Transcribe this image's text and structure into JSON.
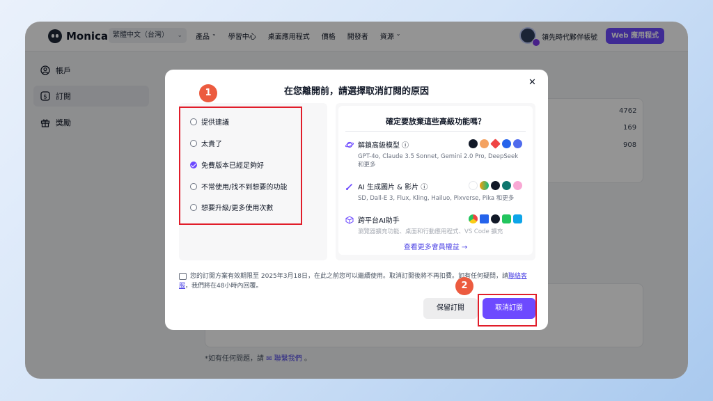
{
  "nav": {
    "brand": "Monica",
    "language": "繁體中文（台灣）",
    "links": [
      "產品",
      "學習中心",
      "桌面應用程式",
      "價格",
      "開發者",
      "資源"
    ],
    "account_label": "領先時代夥伴帳號",
    "web_app_button": "Web 應用程式"
  },
  "sidebar": {
    "items": [
      {
        "label": "帳戶",
        "icon": "user-circle-icon"
      },
      {
        "label": "訂閱",
        "icon": "dollar-icon"
      },
      {
        "label": "獎勵",
        "icon": "gift-icon"
      }
    ]
  },
  "background": {
    "numbers": [
      "4762",
      "169",
      "908"
    ],
    "footer_prefix": "*如有任何問題，請",
    "footer_link": "聯繫我們",
    "footer_suffix": "。"
  },
  "modal": {
    "title": "在您離開前，請選擇取消訂閱的原因",
    "reasons": [
      {
        "label": "提供建議",
        "checked": false
      },
      {
        "label": "太貴了",
        "checked": false
      },
      {
        "label": "免費版本已經足夠好",
        "checked": true
      },
      {
        "label": "不常使用/找不到想要的功能",
        "checked": false
      },
      {
        "label": "想要升級/更多使用次數",
        "checked": false
      }
    ],
    "features_title": "確定要放棄這些高級功能嗎？",
    "features": [
      {
        "title": "解鎖高級模型 ⓘ",
        "desc": "GPT-4o, Claude 3.5 Sonnet, Gemini 2.0 Pro, DeepSeek 和更多",
        "icon": "planet-icon"
      },
      {
        "title": "AI 生成圖片 & 影片 ⓘ",
        "desc": "SD, Dall-E 3, Flux, Kling, Hailuo, Pixverse, Pika 和更多",
        "icon": "brush-icon"
      },
      {
        "title": "跨平台AI助手",
        "desc": "瀏覽器擴充功能、桌面和行動應用程式、VS Code 擴充",
        "icon": "cube-icon"
      }
    ],
    "more_link": "查看更多會員權益 →",
    "notice": "您的訂閱方案有效期限至 2025年3月18日，在此之前您可以繼續使用。取消訂閱後將不再扣費。如有任何疑問，請",
    "notice_link": "聯絡客服",
    "notice_suffix": "，我們將在48小時內回覆。",
    "keep_button": "保留訂閱",
    "cancel_button": "取消訂閱",
    "step1": "1",
    "step2": "2"
  },
  "colors": {
    "accent": "#6d4aff",
    "highlight_red": "#e11d2a",
    "step_badge": "#ec5b3f"
  }
}
